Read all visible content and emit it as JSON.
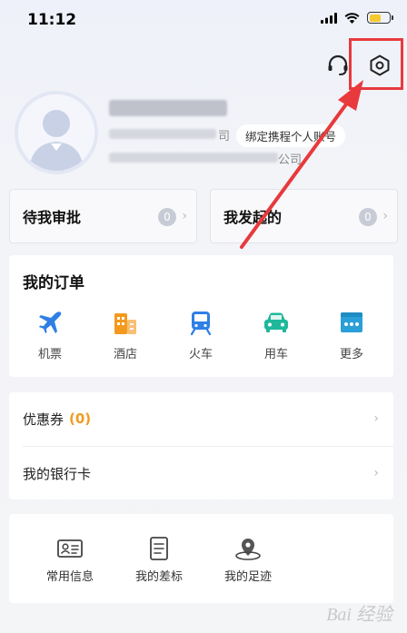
{
  "status_bar": {
    "time": "11:12"
  },
  "profile": {
    "bind_badge": "绑定携程个人账号",
    "line1_suffix": "司",
    "line2_suffix": "公司"
  },
  "approvals": [
    {
      "label": "待我审批",
      "count": "0"
    },
    {
      "label": "我发起的",
      "count": "0"
    }
  ],
  "orders": {
    "title": "我的订单",
    "items": [
      {
        "label": "机票",
        "icon": "plane-icon"
      },
      {
        "label": "酒店",
        "icon": "hotel-icon"
      },
      {
        "label": "火车",
        "icon": "train-icon"
      },
      {
        "label": "用车",
        "icon": "car-icon"
      },
      {
        "label": "更多",
        "icon": "more-icon"
      }
    ]
  },
  "wallet": {
    "coupon_label": "优惠券",
    "coupon_count": "(0)",
    "bank_label": "我的银行卡"
  },
  "tools": [
    {
      "label": "常用信息",
      "icon": "id-card-icon"
    },
    {
      "label": "我的差标",
      "icon": "document-icon"
    },
    {
      "label": "我的足迹",
      "icon": "footprint-icon"
    }
  ],
  "watermark": "Bai 经验",
  "colors": {
    "accent_blue": "#2f7fe6",
    "hotel_orange": "#f39a1e",
    "car_teal": "#1fb89b",
    "highlight_red": "#e8393c"
  }
}
